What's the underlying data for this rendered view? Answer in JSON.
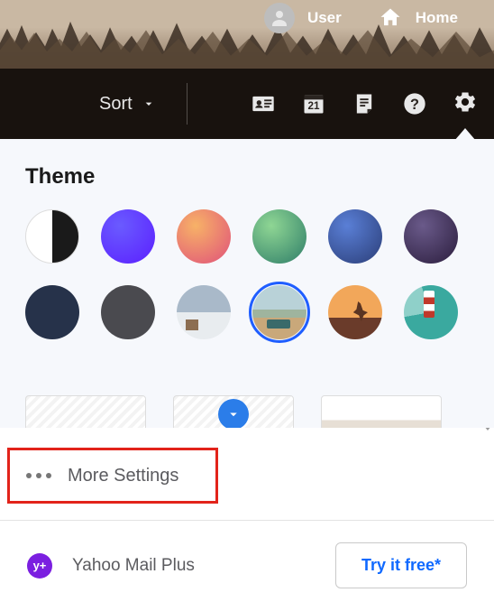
{
  "header": {
    "user_label": "User",
    "home_label": "Home"
  },
  "toolbar": {
    "sort_label": "Sort",
    "calendar_day": "21"
  },
  "panel": {
    "title": "Theme",
    "themes": [
      {
        "name": "black-white"
      },
      {
        "name": "purple"
      },
      {
        "name": "orange-pink"
      },
      {
        "name": "green"
      },
      {
        "name": "blue"
      },
      {
        "name": "dark-purple"
      },
      {
        "name": "navy"
      },
      {
        "name": "gray"
      },
      {
        "name": "snow-cabin"
      },
      {
        "name": "retro-car",
        "selected": true
      },
      {
        "name": "kangaroo"
      },
      {
        "name": "lighthouse"
      }
    ]
  },
  "more_settings": {
    "label": "More Settings"
  },
  "mail_plus": {
    "badge": "y+",
    "label": "Yahoo Mail Plus",
    "cta": "Try it free*"
  }
}
